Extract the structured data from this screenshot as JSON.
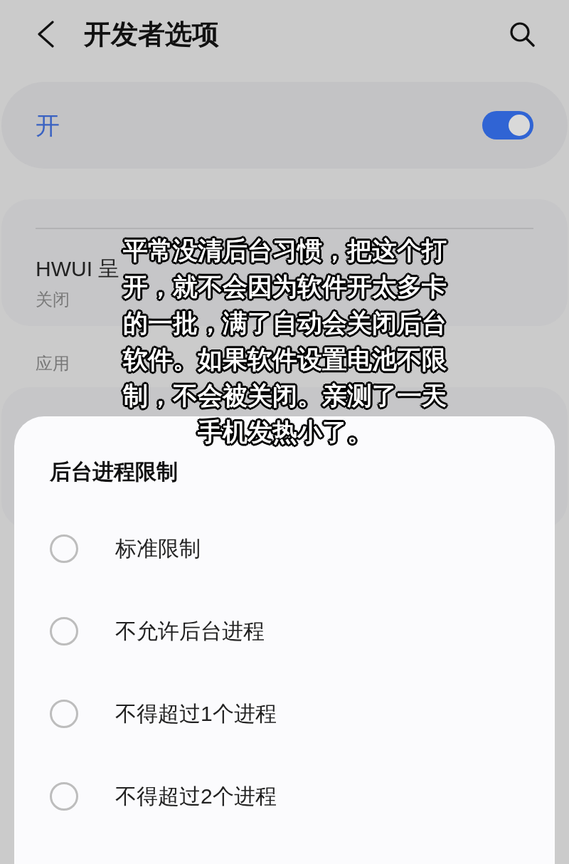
{
  "header": {
    "title": "开发者选项"
  },
  "master_switch": {
    "label": "开",
    "on": true
  },
  "settings": [
    {
      "title": "HWUI 呈",
      "value": "关闭"
    }
  ],
  "section_label": "应用",
  "dialog": {
    "title": "后台进程限制",
    "options": [
      {
        "label": "标准限制",
        "selected": false
      },
      {
        "label": "不允许后台进程",
        "selected": false
      },
      {
        "label": "不得超过1个进程",
        "selected": false
      },
      {
        "label": "不得超过2个进程",
        "selected": false
      }
    ]
  },
  "caption": {
    "lines": [
      "平常没清后台习惯，把这个打",
      "开，就不会因为软件开太多卡",
      "的一批，满了自动会关闭后台",
      "软件。如果软件设置电池不限",
      "制，不会被关闭。亲测了一天",
      "手机发热小了。"
    ]
  }
}
